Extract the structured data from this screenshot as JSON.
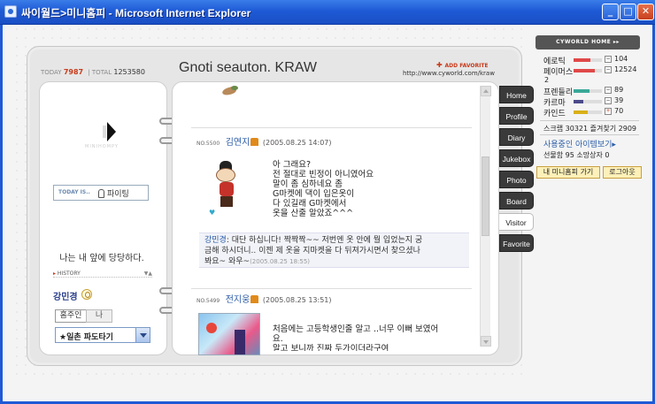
{
  "window": {
    "title": "싸이월드>미니홈피 - Microsoft Internet Explorer",
    "min_symbol": "_",
    "max_symbol": "□",
    "close_symbol": "✕"
  },
  "counter": {
    "today_label": "TODAY",
    "today_value": "7987",
    "separator": "|",
    "total_label": "TOTAL",
    "total_value": "1253580"
  },
  "profile": {
    "caption": "MINIHOMPY",
    "today_is_label": "TODAY IS..",
    "mood": "파이팅",
    "slogan": "나는 내 앞에 당당하다.",
    "history_label": "HISTORY",
    "history_extra": "▼▲",
    "owner_name": "강민경",
    "tab_owner": "홈주인",
    "tab_me": "나",
    "friend_select_value": "★일촌 파도타기"
  },
  "header": {
    "site_title": "Gnoti seauton. KRAW",
    "add_favorite": "ADD FAVORITE",
    "url": "http://www.cyworld.com/kraw"
  },
  "entries": [
    {
      "no_label": "NO.5500",
      "author": "김연지",
      "date": "(2005.08.25 14:07)",
      "lines": [
        "아 그래요?",
        "전 절대로 빈정이 아니였어요",
        "말이 좀 심하네요 좀",
        "G마켓에 댁이 입은옷이",
        "다 있길래 G마켓에서",
        "옷을 산줄 알았죠^^^"
      ],
      "reply": {
        "name": "강민경",
        "line1": ": 대단 하십니다! 짝짝짝~~ 저번엔 옷 안에 뭘 입었는지 궁",
        "line2": "금해 하시더니.. 이젠 제 옷을 지마켓을 다 뒤져가시면서 찾으셨나",
        "line3": "봐요~ 와우~",
        "date": "(2005.08.25 18:55)"
      }
    },
    {
      "no_label": "NO.5499",
      "author": "전지웅",
      "date": "(2005.08.25 13:51)",
      "lines": [
        "처음에는 고등학생인줄 알고 ..너무 이뻐 보였어",
        "요.",
        "알고 보니까 진짜 두가이더라구여"
      ]
    }
  ],
  "menu": [
    "Home",
    "Profile",
    "Diary",
    "Jukebox",
    "Photo",
    "Board",
    "Visitor",
    "Favorite"
  ],
  "menu_active": "Visitor",
  "sidebar": {
    "cy_home": "CYWORLD HOME ▸▸",
    "stats": [
      {
        "name": "에로틱",
        "value": "104",
        "fill": 0.6,
        "color": "#e04848",
        "sign": "−"
      },
      {
        "name": "페이머스",
        "value": "12524",
        "fill": 0.75,
        "color": "#e04848",
        "sign": "−"
      },
      {
        "name": "프렌들리",
        "value": "89",
        "fill": 0.55,
        "color": "#3aa898",
        "sign": "−"
      },
      {
        "name": "카르마",
        "value": "39",
        "fill": 0.35,
        "color": "#4a4a8a",
        "sign": "−"
      },
      {
        "name": "카인드",
        "value": "70",
        "fill": 0.5,
        "color": "#d8b018",
        "sign": "+"
      }
    ],
    "famous_extra": "2",
    "scrap_label": "스크랩",
    "scrap_value": "30321",
    "fav_label": "즐겨찾기",
    "fav_value": "2909",
    "items_link": "사용중인 아이템보기",
    "gift_label": "선물함",
    "gift_value": "95",
    "soldout_label": "소망상자",
    "soldout_value": "0",
    "btn_myhome": "내 미니홈피 가기",
    "btn_logout": "로그아웃"
  }
}
